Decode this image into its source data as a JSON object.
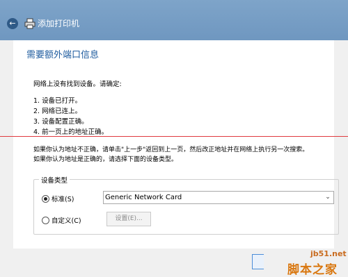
{
  "window": {
    "title": "添加打印机",
    "back_icon": "back-arrow-icon",
    "printer_icon": "printer-icon"
  },
  "content": {
    "heading": "需要额外端口信息",
    "intro": "网络上没有找到设备。请确定:",
    "steps": [
      "1.  设备已打开。",
      "2.  网络已连上。",
      "3.  设备配置正确。",
      "4.  前一页上的地址正确。"
    ],
    "note1": "如果你认为地址不正确，请单击\"上一步\"返回到上一页，然后改正地址并在网络上执行另一次搜索。",
    "note2": "如果你认为地址是正确的，请选择下面的设备类型。"
  },
  "device_type": {
    "legend": "设备类型",
    "standard_label": "标准(S)",
    "standard_selected": true,
    "standard_value": "Generic Network Card",
    "custom_label": "自定义(C)",
    "custom_selected": false,
    "settings_button": "设置(E)..."
  },
  "watermark": {
    "site": "jb51.net",
    "logo": "脚本之家"
  },
  "colors": {
    "titlebar": "#7ea4c9",
    "heading": "#1e5b9e",
    "redline": "#e0393e",
    "watermark": "#d9770f"
  }
}
